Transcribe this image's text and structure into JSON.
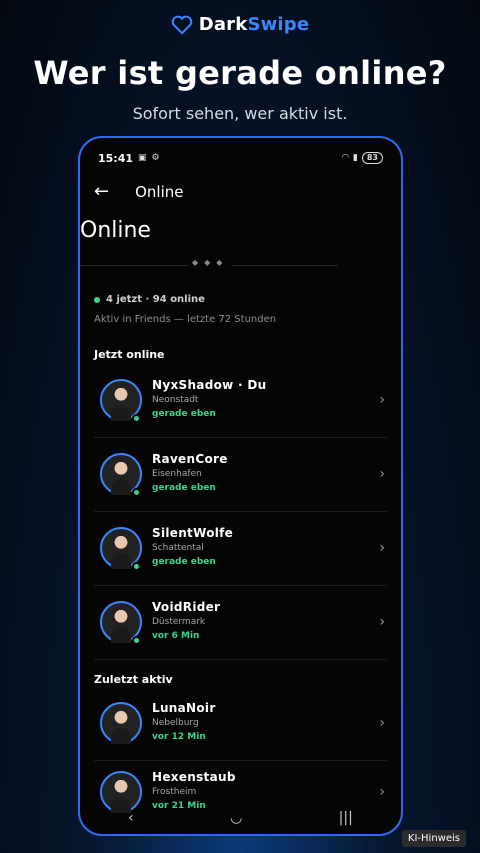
{
  "brand": {
    "dark": "Dark",
    "swipe": "Swipe",
    "icon": "heart-icon",
    "accent": "#3a86ff"
  },
  "headline": "Wer ist gerade online?",
  "subline": "Sofort sehen, wer aktiv ist.",
  "phone": {
    "time": "15:41",
    "battery": "83",
    "status_icons": [
      "screenshot-icon",
      "settings-icon",
      "wifi-icon",
      "signal-icon"
    ],
    "appbar_title": "Online",
    "page_title": "Online",
    "summary": {
      "line": "4 jetzt · 94 online",
      "sub": "Aktiv in Friends — letzte 72 Stunden"
    },
    "sections": [
      {
        "title": "Jetzt online"
      },
      {
        "title": "Zuletzt aktiv"
      }
    ],
    "users": [
      {
        "name": "NyxShadow · Du",
        "city": "Neonstadt",
        "status": "gerade eben",
        "online": true
      },
      {
        "name": "RavenCore",
        "city": "Eisenhafen",
        "status": "gerade eben",
        "online": true
      },
      {
        "name": "SilentWolfe",
        "city": "Schattental",
        "status": "gerade eben",
        "online": true
      },
      {
        "name": "VoidRider",
        "city": "Düstermark",
        "status": "vor 6 Min",
        "online": true
      },
      {
        "name": "LunaNoir",
        "city": "Nebelburg",
        "status": "vor 12 Min",
        "online": false
      },
      {
        "name": "Hexenstaub",
        "city": "Frostheim",
        "status": "vor 21 Min",
        "online": false
      }
    ],
    "nav": [
      "back-nav-icon",
      "home-nav-icon",
      "recents-nav-icon"
    ]
  },
  "ki_label": "KI-Hinweis",
  "colors": {
    "online": "#3fd28a",
    "frame": "#2d6cf0"
  }
}
